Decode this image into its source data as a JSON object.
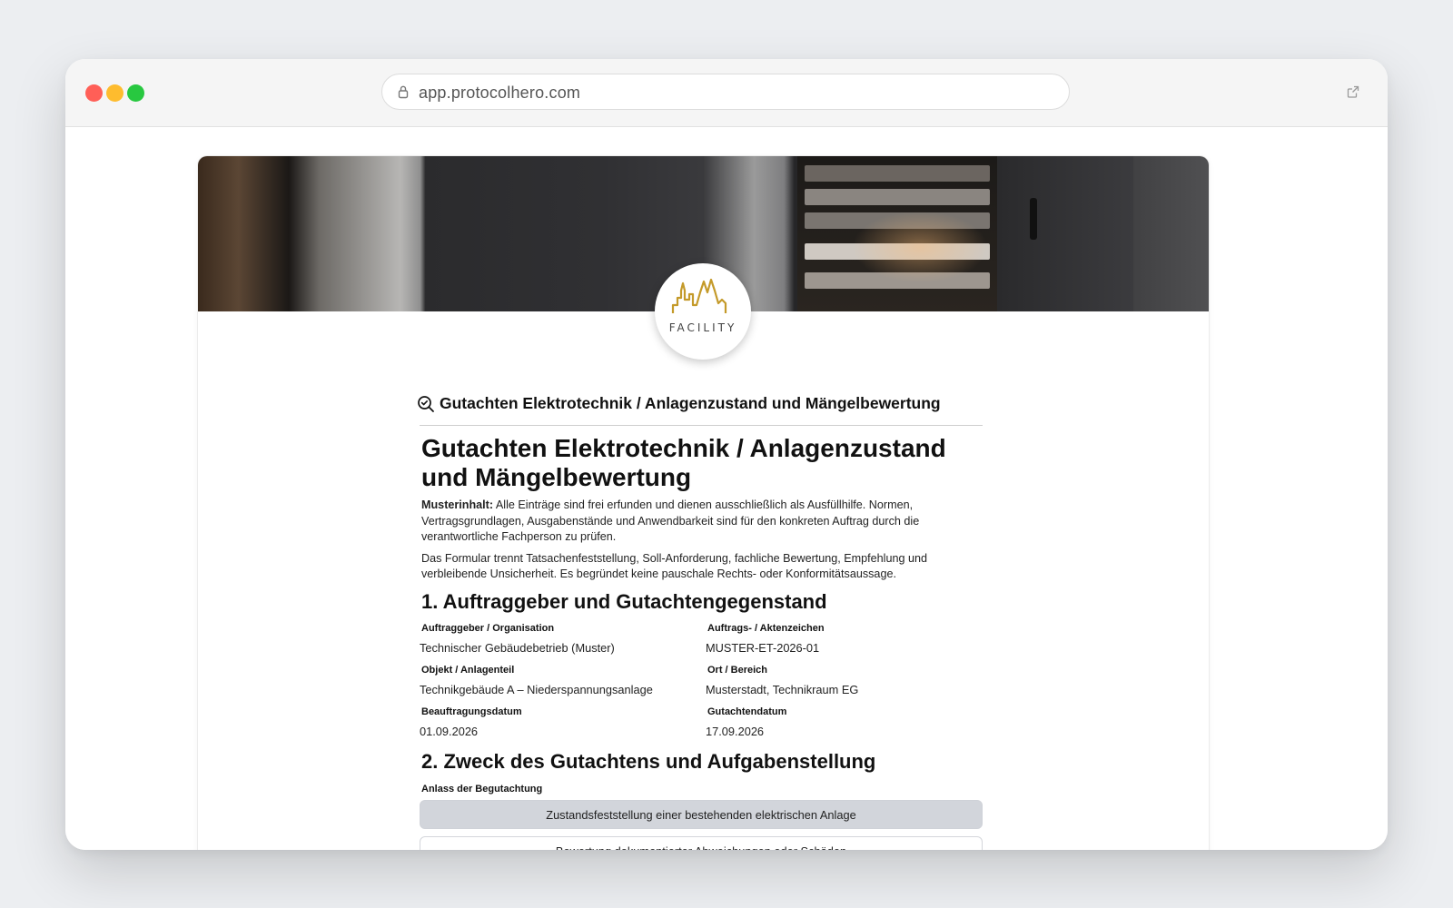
{
  "browser": {
    "url": "app.protocolhero.com"
  },
  "logo": {
    "text": "FACILITY",
    "accent_color": "#c49a2a"
  },
  "form": {
    "header_title": "Gutachten Elektrotechnik / Anlagenzustand und Mängelbewertung",
    "title": "Gutachten Elektrotechnik / Anlagenzustand und Mängelbewertung",
    "notice_label": "Musterinhalt:",
    "notice_text": " Alle Einträge sind frei erfunden und dienen ausschließlich als Ausfüllhilfe. Normen, Vertragsgrundlagen, Ausgabenstände und Anwendbarkeit sind für den konkreten Auftrag durch die verantwortliche Fachperson zu prüfen.",
    "intro_text": "Das Formular trennt Tatsachenfeststellung, Soll-Anforderung, fachliche Bewertung, Empfehlung und verbleibende Unsicherheit. Es begründet keine pauschale Rechts- oder Konformitätsaussage.",
    "section1": {
      "heading": "1. Auftraggeber und Gutachtengegenstand",
      "fields": [
        {
          "label": "Auftraggeber / Organisation",
          "value": "Technischer Gebäudebetrieb (Muster)"
        },
        {
          "label": "Auftrags- / Aktenzeichen",
          "value": "MUSTER-ET-2026-01"
        },
        {
          "label": "Objekt / Anlagenteil",
          "value": "Technikgebäude A – Niederspannungsanlage"
        },
        {
          "label": "Ort / Bereich",
          "value": "Musterstadt, Technikraum EG"
        },
        {
          "label": "Beauftragungsdatum",
          "value": "01.09.2026"
        },
        {
          "label": "Gutachtendatum",
          "value": "17.09.2026"
        }
      ]
    },
    "section2": {
      "heading": "2. Zweck des Gutachtens und Aufgabenstellung",
      "occasion_label": "Anlass der Begutachtung",
      "options": [
        {
          "label": "Zustandsfeststellung einer bestehenden elektrischen Anlage",
          "selected": true
        },
        {
          "label": "Bewertung dokumentierter Abweichungen oder Schäden",
          "selected": false
        }
      ]
    }
  }
}
